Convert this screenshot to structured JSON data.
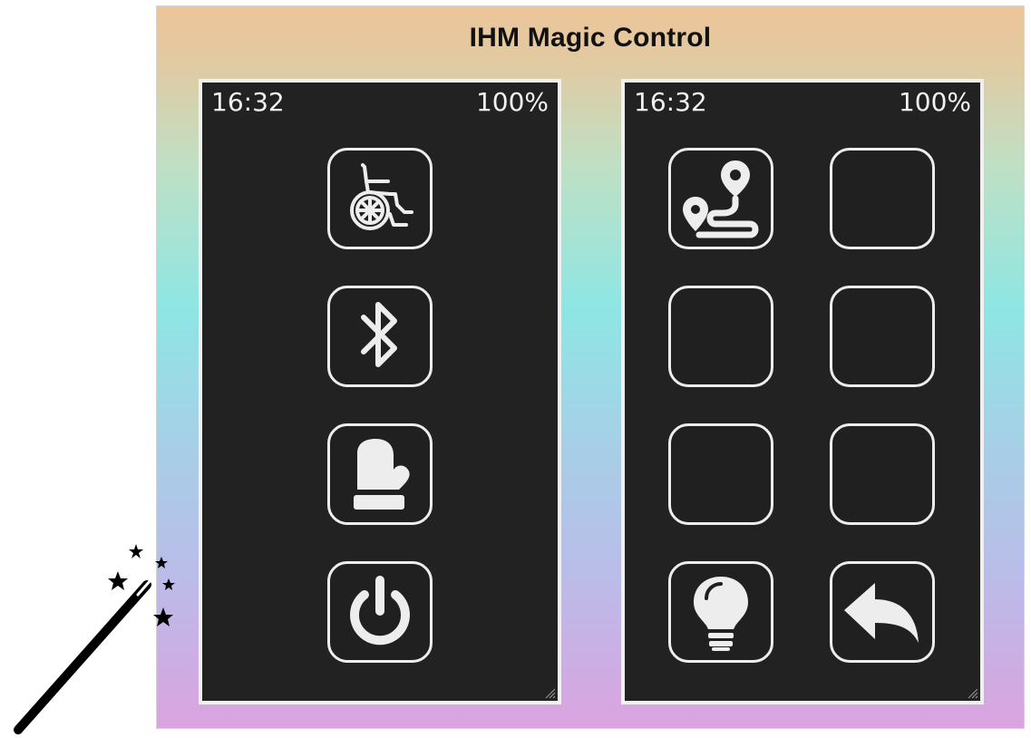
{
  "app": {
    "title": "IHM Magic Control"
  },
  "left_screen": {
    "status": {
      "time": "16:32",
      "battery": "100%"
    },
    "buttons": [
      {
        "name": "wheelchair",
        "icon": "wheelchair-icon"
      },
      {
        "name": "bluetooth",
        "icon": "bluetooth-icon"
      },
      {
        "name": "mitten",
        "icon": "mitten-icon"
      },
      {
        "name": "power",
        "icon": "power-icon"
      }
    ]
  },
  "right_screen": {
    "status": {
      "time": "16:32",
      "battery": "100%"
    },
    "buttons": [
      {
        "name": "route",
        "icon": "route-icon"
      },
      {
        "name": "empty-1",
        "icon": ""
      },
      {
        "name": "empty-2",
        "icon": ""
      },
      {
        "name": "empty-3",
        "icon": ""
      },
      {
        "name": "empty-4",
        "icon": ""
      },
      {
        "name": "empty-5",
        "icon": ""
      },
      {
        "name": "lightbulb",
        "icon": "lightbulb-icon"
      },
      {
        "name": "back",
        "icon": "back-arrow-icon"
      }
    ]
  },
  "decorations": {
    "wand": "magic-wand-icon"
  },
  "colors": {
    "screen_bg": "#222222",
    "icon_fg": "#ededed",
    "gradient_top": "#ecc59a",
    "gradient_middle": "#8ee6e4",
    "gradient_bottom": "#dba3e0"
  }
}
